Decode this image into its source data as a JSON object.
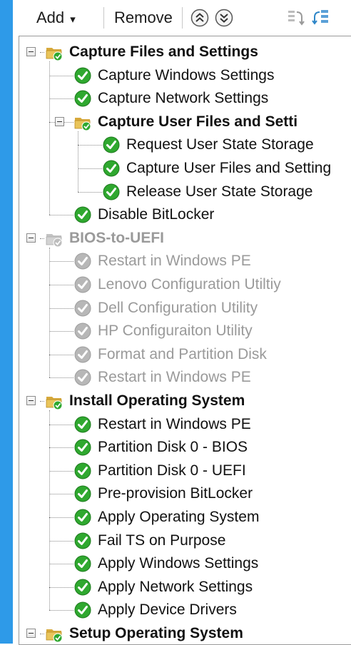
{
  "toolbar": {
    "add_label": "Add",
    "add_chevron": "▾",
    "remove_label": "Remove",
    "move_up_icon": "double-chevron-up-icon",
    "move_down_icon": "double-chevron-down-icon",
    "collapse_icon": "collapse-tree-icon",
    "expand_icon": "expand-tree-icon"
  },
  "colors": {
    "accent_bar": "#2e9ae8",
    "success_green": "#2fa82f",
    "disabled_gray": "#b7b7b7",
    "folder_yellow": "#e9c45a"
  },
  "tree": [
    {
      "label": "Capture Files and Settings",
      "type": "group",
      "level": 0,
      "state": "enabled",
      "icon": "folder-check-icon"
    },
    {
      "label": "Capture Windows Settings",
      "type": "step",
      "level": 1,
      "state": "enabled",
      "icon": "green-check-icon"
    },
    {
      "label": "Capture Network Settings",
      "type": "step",
      "level": 1,
      "state": "enabled",
      "icon": "green-check-icon"
    },
    {
      "label": "Capture User Files and Setti",
      "type": "group",
      "level": 1,
      "state": "enabled",
      "icon": "folder-check-icon"
    },
    {
      "label": "Request User State Storage",
      "type": "step",
      "level": 2,
      "state": "enabled",
      "icon": "green-check-icon"
    },
    {
      "label": "Capture User Files and Setting",
      "type": "step",
      "level": 2,
      "state": "enabled",
      "icon": "green-check-icon"
    },
    {
      "label": "Release User State Storage",
      "type": "step",
      "level": 2,
      "state": "enabled",
      "icon": "green-check-icon"
    },
    {
      "label": "Disable BitLocker",
      "type": "step",
      "level": 1,
      "state": "enabled",
      "icon": "green-check-icon"
    },
    {
      "label": "BIOS-to-UEFI",
      "type": "group",
      "level": 0,
      "state": "disabled",
      "icon": "folder-disabled-icon"
    },
    {
      "label": "Restart in Windows PE",
      "type": "step",
      "level": 1,
      "state": "disabled",
      "icon": "gray-check-icon"
    },
    {
      "label": "Lenovo Configuration Utiltiy",
      "type": "step",
      "level": 1,
      "state": "disabled",
      "icon": "gray-check-icon"
    },
    {
      "label": "Dell Configuration Utility",
      "type": "step",
      "level": 1,
      "state": "disabled",
      "icon": "gray-check-icon"
    },
    {
      "label": "HP Configuraiton Utility",
      "type": "step",
      "level": 1,
      "state": "disabled",
      "icon": "gray-check-icon"
    },
    {
      "label": "Format and Partition Disk",
      "type": "step",
      "level": 1,
      "state": "disabled",
      "icon": "gray-check-icon"
    },
    {
      "label": "Restart in Windows PE",
      "type": "step",
      "level": 1,
      "state": "disabled",
      "icon": "gray-check-icon"
    },
    {
      "label": "Install Operating System",
      "type": "group",
      "level": 0,
      "state": "enabled",
      "icon": "folder-check-icon"
    },
    {
      "label": "Restart in Windows PE",
      "type": "step",
      "level": 1,
      "state": "enabled",
      "icon": "green-check-icon"
    },
    {
      "label": "Partition Disk 0 - BIOS",
      "type": "step",
      "level": 1,
      "state": "enabled",
      "icon": "green-check-icon"
    },
    {
      "label": "Partition Disk 0 - UEFI",
      "type": "step",
      "level": 1,
      "state": "enabled",
      "icon": "green-check-icon"
    },
    {
      "label": "Pre-provision BitLocker",
      "type": "step",
      "level": 1,
      "state": "enabled",
      "icon": "green-check-icon"
    },
    {
      "label": "Apply Operating System",
      "type": "step",
      "level": 1,
      "state": "enabled",
      "icon": "green-check-icon"
    },
    {
      "label": "Fail TS on Purpose",
      "type": "step",
      "level": 1,
      "state": "enabled",
      "icon": "green-check-icon"
    },
    {
      "label": "Apply Windows Settings",
      "type": "step",
      "level": 1,
      "state": "enabled",
      "icon": "green-check-icon"
    },
    {
      "label": "Apply Network Settings",
      "type": "step",
      "level": 1,
      "state": "enabled",
      "icon": "green-check-icon"
    },
    {
      "label": "Apply Device Drivers",
      "type": "step",
      "level": 1,
      "state": "enabled",
      "icon": "green-check-icon"
    },
    {
      "label": "Setup Operating System",
      "type": "group",
      "level": 0,
      "state": "enabled",
      "icon": "folder-check-icon"
    }
  ]
}
